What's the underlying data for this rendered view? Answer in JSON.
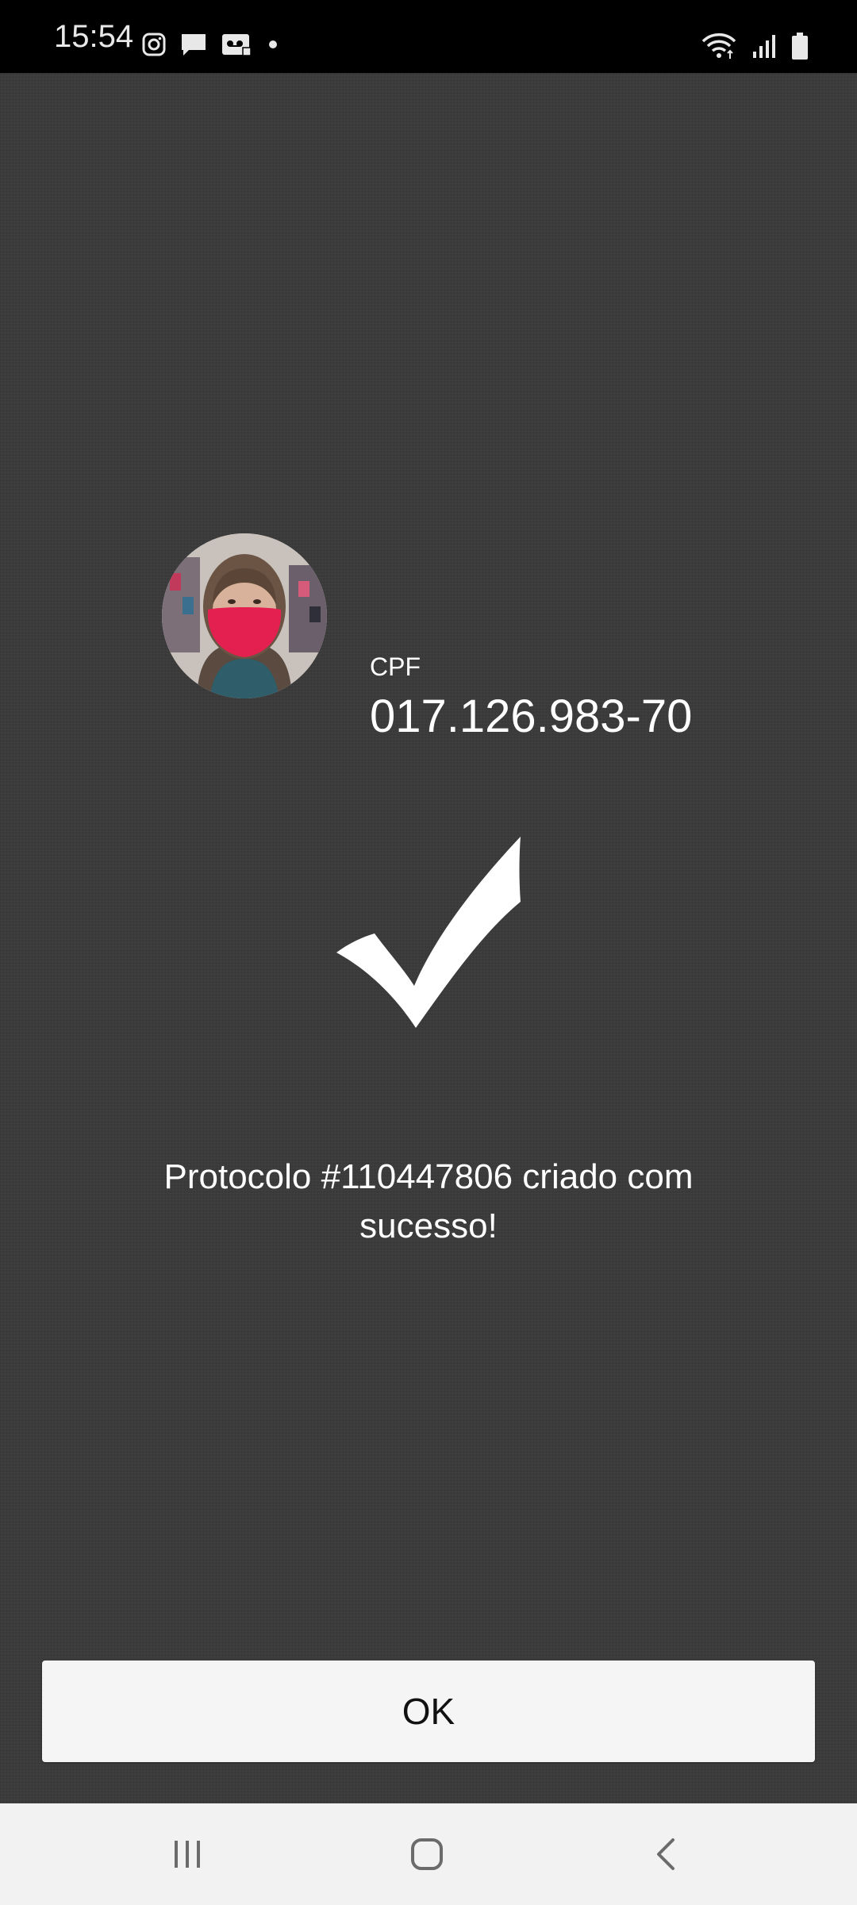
{
  "status_bar": {
    "time": "15:54",
    "left_icons": [
      "instagram-icon",
      "message-icon",
      "voicemail-icon",
      "dot-icon"
    ],
    "right_icons": [
      "wifi-icon",
      "signal-icon",
      "battery-icon"
    ]
  },
  "identity": {
    "avatar": "user-photo",
    "cpf_label": "CPF",
    "cpf_value": "017.126.983-70"
  },
  "result": {
    "icon": "checkmark-icon",
    "message": "Protocolo #110447806 criado com sucesso!"
  },
  "actions": {
    "ok_label": "OK"
  },
  "nav_bar": {
    "buttons": [
      "recents-icon",
      "home-icon",
      "back-icon"
    ]
  },
  "colors": {
    "background": "#3b3b3b",
    "status_bar": "#000000",
    "button_bg": "#f5f5f5",
    "nav_bar": "#f2f2f2",
    "text": "#ffffff",
    "mask": "#e3204f"
  }
}
